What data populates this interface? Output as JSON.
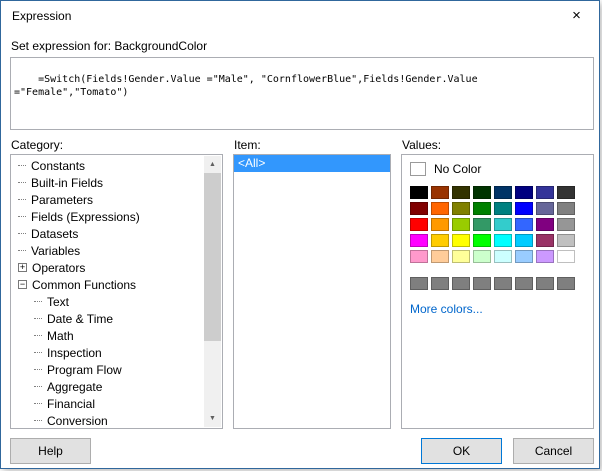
{
  "window": {
    "title": "Expression"
  },
  "icons": {
    "close": "×",
    "scroll_up": "▲",
    "scroll_down": "▼",
    "expand": "+",
    "collapse": "−"
  },
  "expression": {
    "label": "Set expression for: BackgroundColor",
    "value": "=Switch(Fields!Gender.Value =\"Male\", \"CornflowerBlue\",Fields!Gender.Value =\"Female\",\"Tomato\")"
  },
  "category": {
    "label": "Category:",
    "items": [
      {
        "label": "Constants",
        "indent": 0,
        "expander": "none"
      },
      {
        "label": "Built-in Fields",
        "indent": 0,
        "expander": "none"
      },
      {
        "label": "Parameters",
        "indent": 0,
        "expander": "none"
      },
      {
        "label": "Fields (Expressions)",
        "indent": 0,
        "expander": "none"
      },
      {
        "label": "Datasets",
        "indent": 0,
        "expander": "none"
      },
      {
        "label": "Variables",
        "indent": 0,
        "expander": "none"
      },
      {
        "label": "Operators",
        "indent": 0,
        "expander": "plus"
      },
      {
        "label": "Common Functions",
        "indent": 0,
        "expander": "minus"
      },
      {
        "label": "Text",
        "indent": 1,
        "expander": "none"
      },
      {
        "label": "Date & Time",
        "indent": 1,
        "expander": "none"
      },
      {
        "label": "Math",
        "indent": 1,
        "expander": "none"
      },
      {
        "label": "Inspection",
        "indent": 1,
        "expander": "none"
      },
      {
        "label": "Program Flow",
        "indent": 1,
        "expander": "none"
      },
      {
        "label": "Aggregate",
        "indent": 1,
        "expander": "none"
      },
      {
        "label": "Financial",
        "indent": 1,
        "expander": "none"
      },
      {
        "label": "Conversion",
        "indent": 1,
        "expander": "none"
      }
    ]
  },
  "item": {
    "label": "Item:",
    "rows": [
      {
        "label": "<All>",
        "selected": true
      }
    ]
  },
  "values": {
    "label": "Values:",
    "no_color": "No Color",
    "more_colors": "More colors...",
    "palette": [
      [
        "#000000",
        "#993300",
        "#333300",
        "#003300",
        "#003366",
        "#000080",
        "#333399",
        "#333333"
      ],
      [
        "#800000",
        "#FF6600",
        "#808000",
        "#008000",
        "#008080",
        "#0000FF",
        "#666699",
        "#808080"
      ],
      [
        "#FF0000",
        "#FF9900",
        "#99CC00",
        "#339966",
        "#33CCCC",
        "#3366FF",
        "#800080",
        "#969696"
      ],
      [
        "#FF00FF",
        "#FFCC00",
        "#FFFF00",
        "#00FF00",
        "#00FFFF",
        "#00CCFF",
        "#993366",
        "#C0C0C0"
      ],
      [
        "#FF99CC",
        "#FFCC99",
        "#FFFF99",
        "#CCFFCC",
        "#CCFFFF",
        "#99CCFF",
        "#CC99FF",
        "#FFFFFF"
      ]
    ],
    "grays": [
      "#7F7F7F",
      "#7F7F7F",
      "#7F7F7F",
      "#7F7F7F",
      "#7F7F7F",
      "#7F7F7F",
      "#7F7F7F",
      "#7F7F7F"
    ]
  },
  "buttons": {
    "help": "Help",
    "ok": "OK",
    "cancel": "Cancel"
  },
  "colors": {
    "dialog_border": "#30679C",
    "accent": "#0078D7",
    "selection": "#3297FD",
    "link": "#0066CC",
    "button_face": "#E1E1E1"
  }
}
